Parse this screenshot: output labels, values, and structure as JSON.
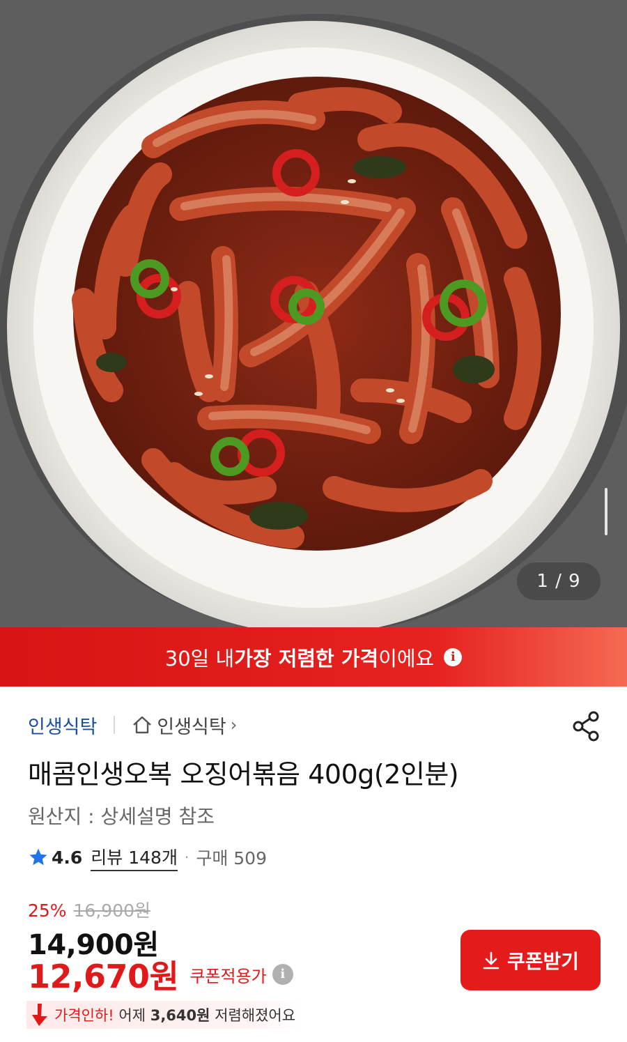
{
  "gallery": {
    "page_counter": "1 / 9",
    "current_index": 1,
    "total_images": 9
  },
  "banner": {
    "text_prefix": "30일 내 ",
    "text_strong": "가장 저렴한 가격",
    "text_suffix": "이에요"
  },
  "seller": {
    "name": "인생식탁",
    "store_link_label": "인생식탁"
  },
  "product": {
    "title": "매콤인생오복 오징어볶음 400g(2인분)",
    "origin": "원산지 : 상세설명 참조",
    "rating": "4.6",
    "review_label": "리뷰 148개",
    "purchase_label": "구매 509"
  },
  "price": {
    "discount_rate": "25%",
    "original_price": "16,900원",
    "sale_price": "14,900원",
    "coupon_price": "12,670원",
    "coupon_price_label": "쿠폰적용가",
    "drop_prefix": "가격인하!",
    "drop_middle": " 어제 ",
    "drop_amount": "3,640원",
    "drop_suffix": " 저렴해졌어요"
  },
  "coupon_button": {
    "label": "쿠폰받기"
  },
  "colors": {
    "accent_red": "#e01a1a",
    "seller_blue": "#1a4fa0",
    "star_blue": "#1e74e8"
  }
}
